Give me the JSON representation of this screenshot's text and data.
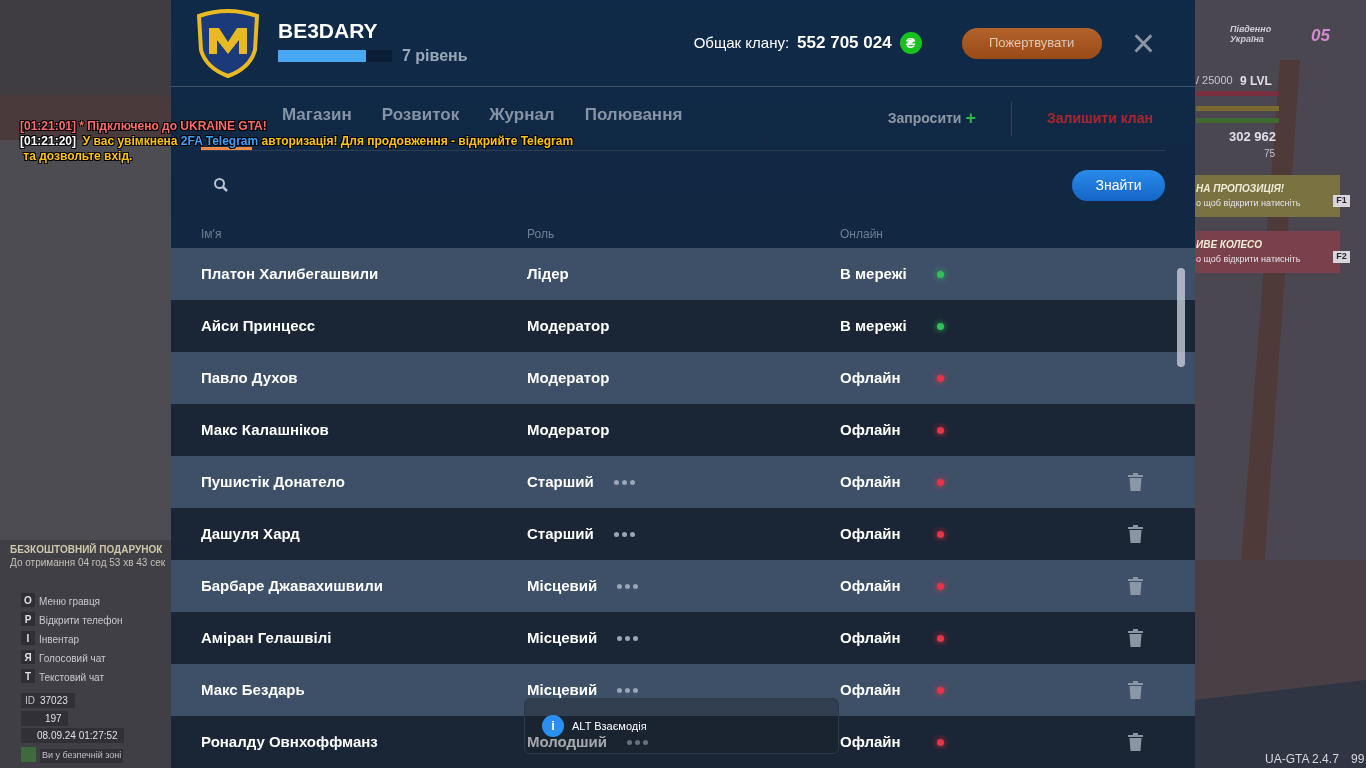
{
  "clan": {
    "name": "BE3DARY",
    "level": 0.77,
    "level_text": "7 рівень",
    "treasury_label": "Общак клану:",
    "treasury": "552 705 024",
    "currency_symbol": "₴",
    "donate_button": "Пожертвувати",
    "close": "×"
  },
  "tabs": [
    {
      "selected": true
    },
    {
      "label": "Магазин",
      "selected": false
    },
    {
      "label": "Розвиток",
      "selected": false
    },
    {
      "label": "Журнал",
      "selected": false
    },
    {
      "label": "Полювання",
      "selected": false
    }
  ],
  "invite": {
    "label": "Запросити",
    "icon": "+"
  },
  "leave": "Залишити клан",
  "search": {
    "button": "Знайти"
  },
  "columns": [
    "Ім'я",
    "Роль",
    "Онлайн"
  ],
  "members": [
    {
      "name": "Платон Халибегашвили",
      "role": "Лідер",
      "menu": false,
      "status": "В мережі",
      "online": true,
      "removable": false
    },
    {
      "name": "Айси Принцесс",
      "role": "Модератор",
      "menu": false,
      "status": "В мережі",
      "online": true,
      "removable": false
    },
    {
      "name": "Павло Духов",
      "role": "Модератор",
      "menu": false,
      "status": "Офлайн",
      "online": false,
      "removable": false
    },
    {
      "name": "Макс Калашніков",
      "role": "Модератор",
      "menu": false,
      "status": "Офлайн",
      "online": false,
      "removable": false
    },
    {
      "name": "Пушистік Донатело",
      "role": "Старший",
      "menu": true,
      "status": "Офлайн",
      "online": false,
      "removable": true
    },
    {
      "name": "Дашуля Хард",
      "role": "Старший",
      "menu": true,
      "status": "Офлайн",
      "online": false,
      "removable": true
    },
    {
      "name": "Барбаре Джавахишвили",
      "role": "Місцевий",
      "menu": true,
      "status": "Офлайн",
      "online": false,
      "removable": true
    },
    {
      "name": "Аміран Гелашвілі",
      "role": "Місцевий",
      "menu": true,
      "status": "Офлайн",
      "online": false,
      "removable": true
    },
    {
      "name": "Макс Бездарь",
      "role": "Місцевий",
      "menu": true,
      "status": "Офлайн",
      "online": false,
      "removable": true
    },
    {
      "name": "Роналду Овнхоффманз",
      "role": "Молодший",
      "menu": true,
      "status": "Офлайн",
      "online": false,
      "removable": true
    }
  ],
  "toast": {
    "text": "ALT Взаємодія",
    "icon": "i"
  },
  "chat": [
    [
      {
        "text": "[01:21:01]",
        "color": "#ff6b6b"
      },
      {
        "text": " * Підключено до UKRAINE GTA!",
        "color": "#ff6b6b"
      }
    ],
    [
      {
        "text": "[01:21:20]",
        "color": "#ffffff"
      },
      {
        "text": "  У вас увімкнена ",
        "color": "#ffc400"
      },
      {
        "text": "2FA Telegram",
        "color": "#3ea0ff"
      },
      {
        "text": " авторизація! Для продовження - відкрийте Telegram",
        "color": "#ffc400"
      }
    ],
    [
      {
        "text": " та дозвольте вхід.",
        "color": "#ffc400"
      }
    ]
  ],
  "hud_left": {
    "gift_title": "БЕЗКОШТОВНИЙ ПОДАРУНОК",
    "gift_timer": "До отримання 04 год 53 хв 43 сек",
    "keys": [
      {
        "key": "O",
        "label": "Меню гравця"
      },
      {
        "key": "P",
        "label": "Відкрити телефон"
      },
      {
        "key": "I",
        "label": "Інвентар"
      },
      {
        "key": "Я",
        "label": "Голосовий чат"
      },
      {
        "key": "T",
        "label": "Текстовий чат"
      }
    ],
    "id_label": "ID",
    "id": "37023",
    "players": "197",
    "datetime": "08.09.24 01:27:52",
    "zone": "Ви у безпечній зоні"
  },
  "hud_right": {
    "region": "Південно Україна",
    "server": "05",
    "xp": "/ 25000",
    "level": "9 LVL",
    "money": "302 962",
    "coins": "75",
    "offers": [
      {
        "title": "НА ПРОПОЗИЦІЯ!",
        "hint": "о щоб відкрити натисніть",
        "key": "F1",
        "color": "#7a7341"
      },
      {
        "title": "ИВЕ КОЛЕСО",
        "hint": "о щоб відкрити натисніть",
        "key": "F2",
        "color": "#7a414a"
      }
    ]
  },
  "version": "UA-GTA 2.4.7",
  "fps": "99"
}
